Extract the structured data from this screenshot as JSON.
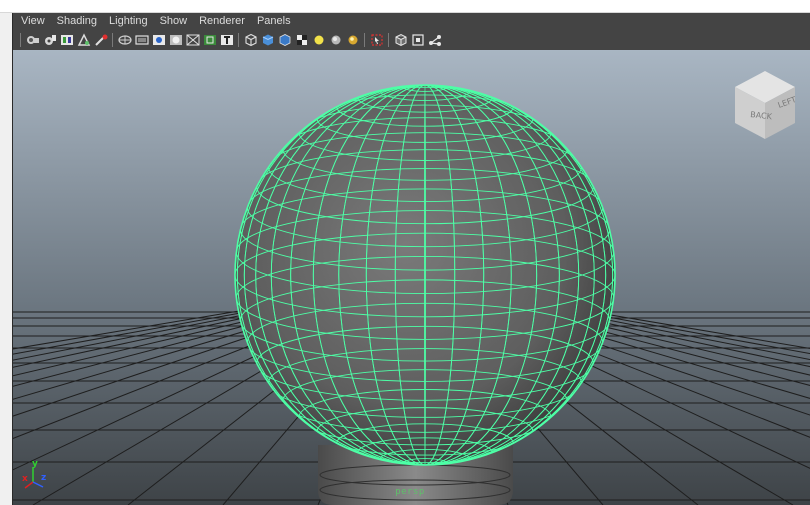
{
  "menubar": {
    "items": [
      "View",
      "Shading",
      "Lighting",
      "Show",
      "Renderer",
      "Panels"
    ]
  },
  "toolbar": {
    "groups": [
      [
        "camera-attributes-icon",
        "bookmark-camera-icon",
        "image-plane-icon",
        "grid-2d-pan-zoom-icon",
        "grease-pencil-icon"
      ],
      [
        "grid-toggle-icon",
        "film-gate-icon",
        "resolution-gate-icon",
        "gate-mask-icon",
        "field-chart-icon",
        "safe-action-icon",
        "safe-title-icon"
      ],
      [
        "wireframe-icon",
        "smooth-shade-icon",
        "default-material-icon",
        "textured-icon",
        "use-all-lights-icon",
        "shadows-icon",
        "ambient-occlusion-icon"
      ],
      [
        "isolate-select-icon",
        "xray-icon",
        "xray-active-components-icon",
        "xray-joints-icon"
      ]
    ]
  },
  "viewport": {
    "camera_name": "persp",
    "viewcube": {
      "back_label": "BACK",
      "left_label": "LEFT"
    },
    "axes": {
      "x": "x",
      "y": "y",
      "z": "z"
    },
    "colors": {
      "wireframe": "#4dffa6",
      "background_top": "#a9b6c3",
      "background_bottom": "#3e4347",
      "grid": "#1e1e1e"
    }
  }
}
